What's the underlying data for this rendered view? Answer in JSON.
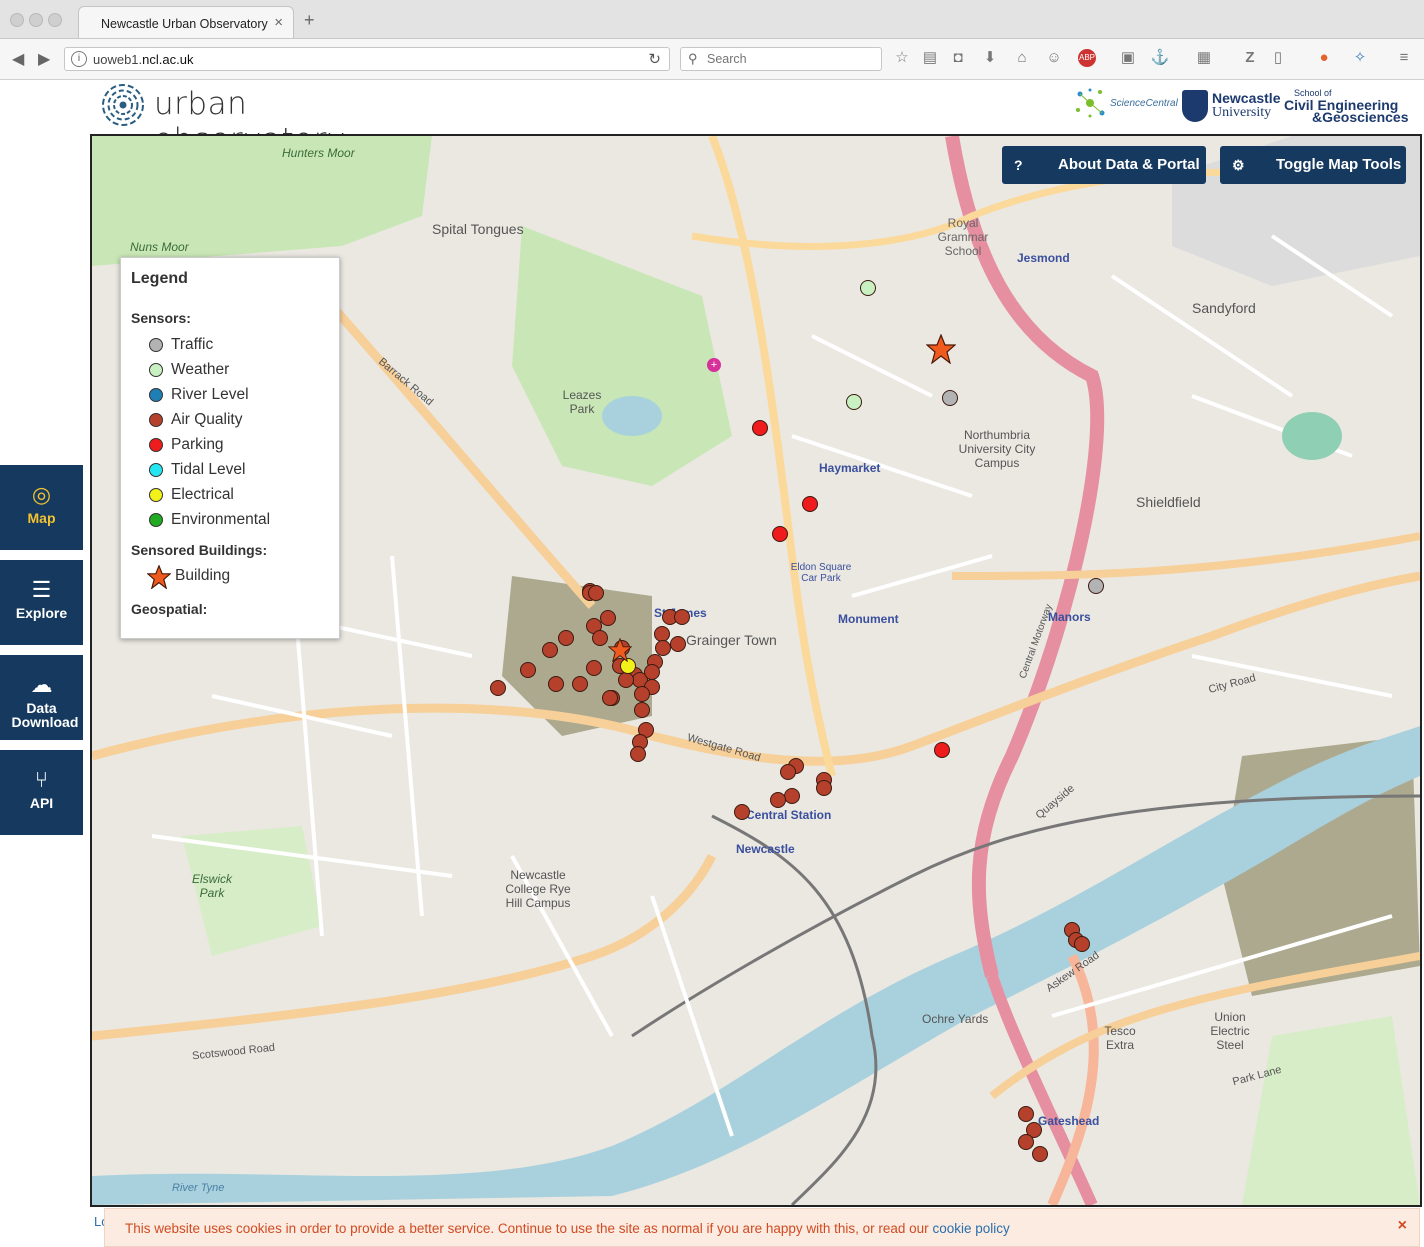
{
  "browser": {
    "tab_title": "Newcastle Urban Observatory",
    "url_host_prefix": "uoweb1.",
    "url_host_main": "ncl.ac.uk",
    "search_placeholder": "Search"
  },
  "header": {
    "logo_text": "urban observatory",
    "partner_sciencecentral": "ScienceCentral",
    "partner_ncl_line1": "Newcastle",
    "partner_ncl_line2": "University",
    "partner_ceg_small": "School of",
    "partner_ceg_line1": "Civil Engineering",
    "partner_ceg_line2": "&Geosciences"
  },
  "sidebar": {
    "items": [
      {
        "label": "Map",
        "icon": "compass-icon"
      },
      {
        "label": "Explore",
        "icon": "database-icon"
      },
      {
        "label": "Data Download",
        "icon": "cloud-download-icon"
      },
      {
        "label": "API",
        "icon": "branch-icon"
      }
    ]
  },
  "map_toolbar": {
    "about_label": "About Data & Portal",
    "toggle_label": "Toggle Map Tools"
  },
  "legend": {
    "title": "Legend",
    "sensors_heading": "Sensors:",
    "sensors": [
      {
        "label": "Traffic",
        "color": "#b3b3b3"
      },
      {
        "label": "Weather",
        "color": "#c8f0c0"
      },
      {
        "label": "River Level",
        "color": "#1f7fb5"
      },
      {
        "label": "Air Quality",
        "color": "#b5412c"
      },
      {
        "label": "Parking",
        "color": "#ee1c1c"
      },
      {
        "label": "Tidal Level",
        "color": "#25e6f0"
      },
      {
        "label": "Electrical",
        "color": "#f2f21a"
      },
      {
        "label": "Environmental",
        "color": "#22aa22"
      }
    ],
    "buildings_heading": "Sensored Buildings:",
    "building_label": "Building",
    "geospatial_heading": "Geospatial:"
  },
  "map_labels": [
    "Hunters Moor",
    "Nuns Moor",
    "Spital Tongues",
    "Leazes Park",
    "Haymarket",
    "Jesmond",
    "Sandyford",
    "Northumbria University City Campus",
    "Shieldfield",
    "Grainger Town",
    "St James",
    "Monument",
    "Manors",
    "Central Station",
    "Newcastle",
    "Elswick Park",
    "Newcastle College Rye Hill Campus",
    "Ochre Yards",
    "Tesco Extra",
    "Union Electric Steel",
    "Gateshead",
    "Barrack Road",
    "Westgate Road",
    "Scotswood Road",
    "City Road",
    "Quayside",
    "Askew Road",
    "Park Lane",
    "Royal Grammar School",
    "Eldon Square Car Park",
    "River Tyne",
    "Central Motorway"
  ],
  "cookie": {
    "message": "This website uses cookies in order to provide a better service. Continue to use the site as normal if you are happy with this, or read our",
    "link": "cookie policy",
    "close": "×"
  },
  "corner_text": "Lo"
}
